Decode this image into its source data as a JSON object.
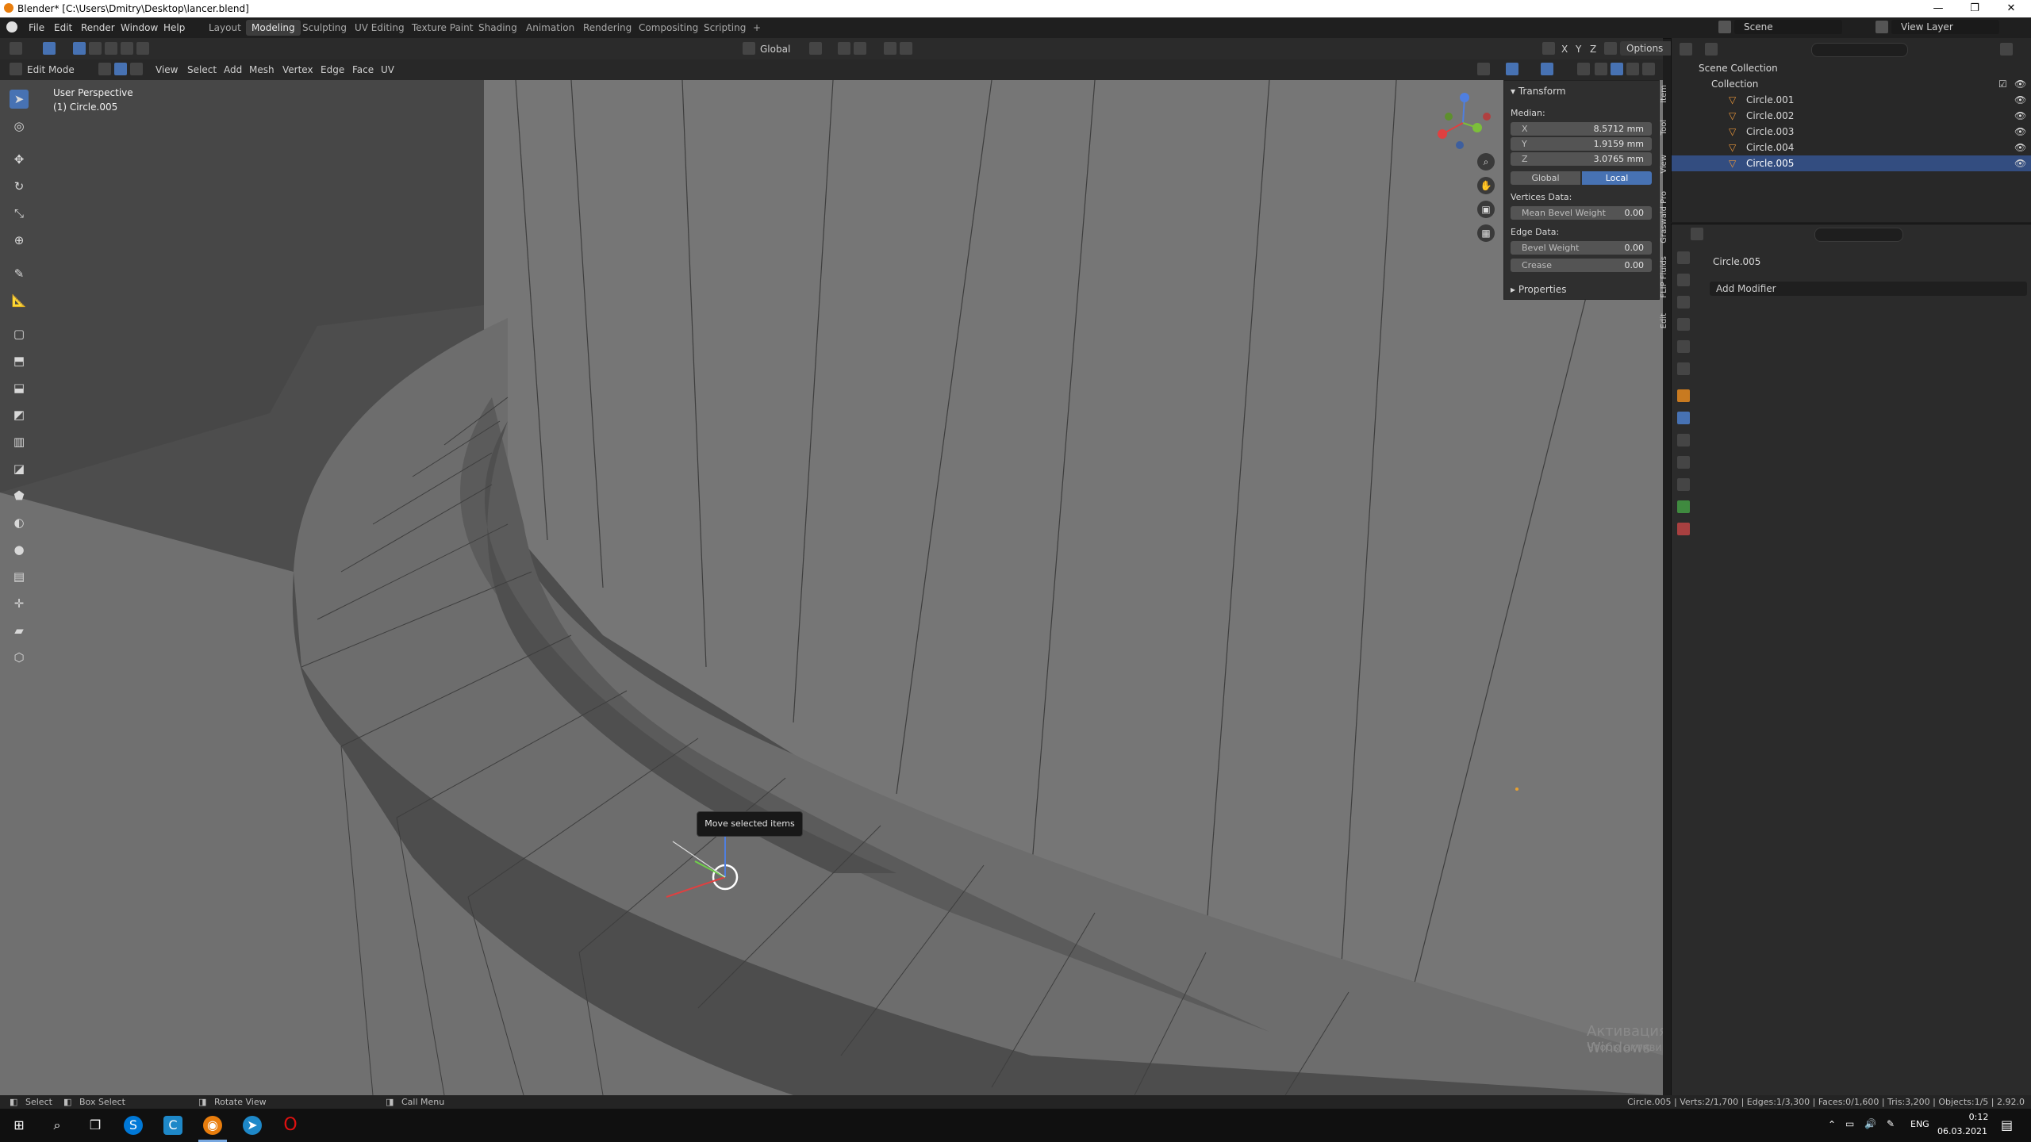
{
  "window": {
    "title": "Blender* [C:\\Users\\Dmitry\\Desktop\\lancer.blend]",
    "minimize": "—",
    "maximize": "❐",
    "close": "✕"
  },
  "menu": {
    "items": [
      "File",
      "Edit",
      "Render",
      "Window",
      "Help"
    ],
    "workspaces": [
      "Layout",
      "Modeling",
      "Sculpting",
      "UV Editing",
      "Texture Paint",
      "Shading",
      "Animation",
      "Rendering",
      "Compositing",
      "Scripting"
    ],
    "add_workspace": "+",
    "active_workspace": "Modeling",
    "scene_label": "Scene",
    "view_layer_label": "View Layer"
  },
  "viewport_header": {
    "mode": "Edit Mode",
    "menus": [
      "View",
      "Select",
      "Add",
      "Mesh",
      "Vertex",
      "Edge",
      "Face",
      "UV"
    ],
    "transform_orientation": "Global",
    "options": "Options",
    "axes": [
      "X",
      "Y",
      "Z"
    ]
  },
  "viewport": {
    "perspective": "User Perspective",
    "object": "(1) Circle.005",
    "tooltip": "Move selected items",
    "watermark_title": "Активация Windows",
    "watermark_sub": "Чтобы активировать Windows, перейдите в раздел \"Параметры\"."
  },
  "npanel": {
    "section_transform": "Transform",
    "median_label": "Median:",
    "x_label": "X",
    "x": "8.5712 mm",
    "y_label": "Y",
    "y": "1.9159 mm",
    "z_label": "Z",
    "z": "3.0765 mm",
    "global": "Global",
    "local": "Local",
    "vertices_data": "Vertices Data:",
    "mean_bevel_weight": "Mean Bevel Weight",
    "mean_bevel_weight_value": "0.00",
    "edge_data": "Edge Data:",
    "bevel_weight": "Bevel Weight",
    "bevel_weight_value": "0.00",
    "crease": "Crease",
    "crease_value": "0.00",
    "section_properties": "Properties",
    "tabs": [
      "Item",
      "Tool",
      "View",
      "Graswald Pro",
      "FLIP Fluids",
      "Edit"
    ]
  },
  "outliner": {
    "scene_collection": "Scene Collection",
    "collection": "Collection",
    "objects": [
      "Circle.001",
      "Circle.002",
      "Circle.003",
      "Circle.004",
      "Circle.005"
    ],
    "selected": "Circle.005"
  },
  "properties": {
    "object_name": "Circle.005",
    "add_modifier": "Add Modifier"
  },
  "statusbar": {
    "select": "Select",
    "box_select": "Box Select",
    "rotate_view": "Rotate View",
    "call_menu": "Call Menu",
    "stats": "Circle.005 | Verts:2/1,700 | Edges:1/3,300 | Faces:0/1,600 | Tris:3,200 | Objects:1/5 | 2.92.0"
  },
  "taskbar": {
    "lang": "ENG",
    "time": "0:12",
    "date": "06.03.2021"
  }
}
